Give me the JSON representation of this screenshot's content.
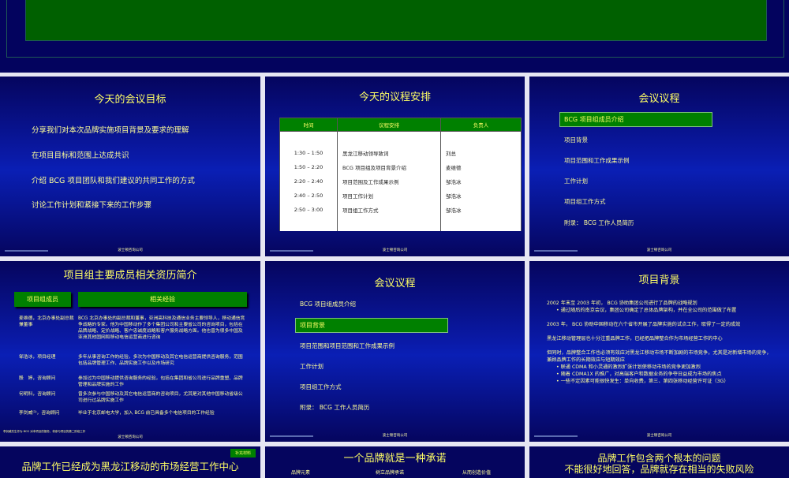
{
  "footer": "波士顿咨询公司",
  "slides": [
    {
      "title": "今天的会议目标",
      "items": [
        "分享我们对本次品牌实施项目背景及要求的理解",
        "在项目目标和范围上达成共识",
        "介绍 BCG 项目团队和我们建议的共同工作的方式",
        "讨论工作计划和紧接下来的工作步骤"
      ]
    },
    {
      "title": "今天的议程安排",
      "headers": [
        "时间",
        "议程安排",
        "负责人"
      ],
      "rows": [
        [
          "1:30 – 1:50",
          "黑龙江移动领导致词",
          "刘总"
        ],
        [
          "1:50 – 2:20",
          "BCG 项目组及项目背景介绍",
          "麦维德"
        ],
        [
          "2:20 – 2:40",
          "项目范围及工作成果示例",
          "邹浩冰"
        ],
        [
          "2:40 – 2:50",
          "项目工作计划",
          "邹浩冰"
        ],
        [
          "2:50 – 3:00",
          "项目组工作方式",
          "邹浩冰"
        ]
      ]
    },
    {
      "title": "会议议程",
      "items": [
        "BCG 项目组成员介绍",
        "项目背景",
        "项目范围和工作成果示例",
        "工作计划",
        "项目组工作方式",
        "附录： BCG 工作人员简历"
      ]
    },
    {
      "title": "项目组主要成员相关资历简介",
      "headers": [
        "项目组成员",
        "相关经验"
      ],
      "members": [
        {
          "name": "麦维德，北京办事处副总裁兼董事",
          "exp": "BCG 北京办事处的副总裁和董事，亚洲高科技及通信业务主要领导人，移动通信竞争战略的专家。他为中国移动作了多个集团公司和主要省公司的咨询项目，包括在品牌战略、定价战略、客户忠诚度战略和客户服务战略方面。他也曾为很多中国及亚洲其他固网和移动电信运营商进行咨询"
        },
        {
          "name": "邹浩冰，项目经理",
          "exp": "多年从事咨询工作的经验，多次为中国移动及其它电信运营商提供咨询服务，范围包括品牌管理工作、品牌实施工作以及市场研究"
        },
        {
          "name": "殷　婷，咨询顾问",
          "exp": "参加过为中国移动提供咨询服务的经验，包括在集团和省公司进行品牌重塑、品牌管理和品牌实施的工作"
        },
        {
          "name": "何明科，咨询顾问",
          "exp": "曾多次参与中国移动及其它电信运营商的咨询项目，尤其是对其他中国移动省级公司进行过品牌实施工作"
        },
        {
          "name": "李剑威⁽¹⁾，咨询顾问",
          "exp": "毕业于北京邮电大学，加入 BCG 前已具备多个电信项目的工作经验"
        }
      ],
      "note": "李剑威先生作为 BCG 对本项目的报务，将参与项目的第二阶段工作"
    },
    {
      "title": "会议议程",
      "items": [
        "BCG 项目组成员介绍",
        "项目背景",
        "项目范围和项目范围和工作成果示例",
        "工作计划",
        "项目组工作方式",
        "附录： BCG 工作人员简历"
      ]
    },
    {
      "title": "项目背景",
      "p1": "2002 年末至 2003 年初， BCG 协助集团公司进行了品牌的战略规划",
      "b1": "通过随后的南京会议，集团公司确定了总体品牌架构，并在全公司的范围做了布置",
      "p2": "2003 年， BCG 协助中国移动在六个省市开展了品牌实施的试点工作，取得了一定的成效",
      "p3": "黑龙江移动管理层也十分注重品牌工作，已经把品牌整合作为市场经营工作的中心",
      "p4": "但同时，品牌整合工作也必须有效应对黑龙江移动市场不断加剧的市场竞争，尤其是对新增市场的竞争，兼顾品牌工作的长期效应与短期效应",
      "b4": [
        "联通 CDMA 和小灵通的激烈扩张计划使移动市场的竞争更加激烈",
        "随着 CDMA1X 的推广，对高端客户和数据业务的争夺日益成为市场的焦点",
        "一些不定因素可能很快发生：单向收费，第三、第四张移动经营许可证（3G）"
      ]
    },
    {
      "tag": "补充材料",
      "title": "品牌工作已经成为黑龙江移动的市场经营工作中心"
    },
    {
      "title": "一个品牌就是一种承诺",
      "cols": [
        "品牌元素",
        "树立品牌承诺",
        "从而创造价值"
      ]
    },
    {
      "title": "品牌工作包含两个根本的问题",
      "subtitle": "不能很好地回答，品牌就存在相当的失败风险"
    }
  ]
}
